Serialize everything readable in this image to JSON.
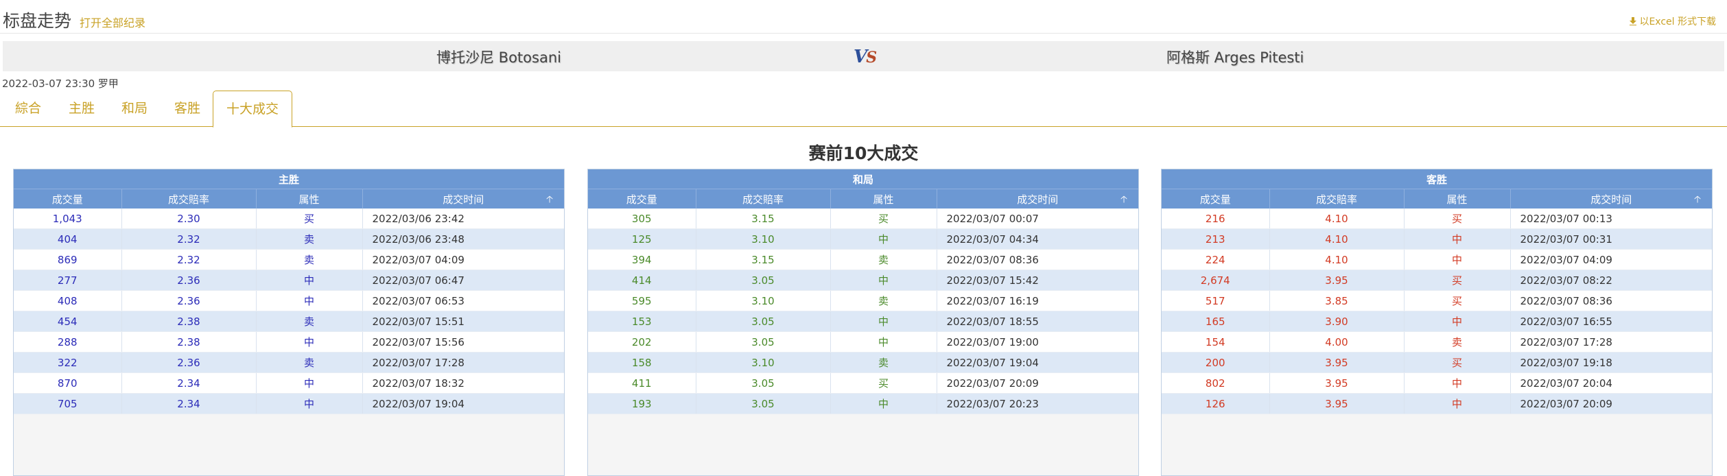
{
  "header": {
    "title": "标盘走势",
    "open_all": "打开全部纪录",
    "export_label": "以Excel 形式下载"
  },
  "match": {
    "home_team": "博托沙尼 Botosani",
    "away_team": "阿格斯 Arges Pitesti",
    "vs_v": "V",
    "vs_s": "S",
    "info": "2022-03-07 23:30 罗甲"
  },
  "tabs": [
    "綜合",
    "主胜",
    "和局",
    "客胜",
    "十大成交"
  ],
  "active_tab": "十大成交",
  "section_title": "赛前10大成交",
  "columns": [
    "成交量",
    "成交賠率",
    "属性",
    "成交时间"
  ],
  "sort_arrow": "🡡",
  "panels": {
    "home": {
      "caption": "主胜",
      "rows": [
        [
          "1,043",
          "2.30",
          "买",
          "2022/03/06 23:42"
        ],
        [
          "404",
          "2.32",
          "卖",
          "2022/03/06 23:48"
        ],
        [
          "869",
          "2.32",
          "卖",
          "2022/03/07 04:09"
        ],
        [
          "277",
          "2.36",
          "中",
          "2022/03/07 06:47"
        ],
        [
          "408",
          "2.36",
          "中",
          "2022/03/07 06:53"
        ],
        [
          "454",
          "2.38",
          "卖",
          "2022/03/07 15:51"
        ],
        [
          "288",
          "2.38",
          "中",
          "2022/03/07 15:56"
        ],
        [
          "322",
          "2.36",
          "卖",
          "2022/03/07 17:28"
        ],
        [
          "870",
          "2.34",
          "中",
          "2022/03/07 18:32"
        ],
        [
          "705",
          "2.34",
          "中",
          "2022/03/07 19:04"
        ]
      ]
    },
    "draw": {
      "caption": "和局",
      "rows": [
        [
          "305",
          "3.15",
          "买",
          "2022/03/07 00:07"
        ],
        [
          "125",
          "3.10",
          "中",
          "2022/03/07 04:34"
        ],
        [
          "394",
          "3.15",
          "卖",
          "2022/03/07 08:36"
        ],
        [
          "414",
          "3.05",
          "中",
          "2022/03/07 15:42"
        ],
        [
          "595",
          "3.10",
          "卖",
          "2022/03/07 16:19"
        ],
        [
          "153",
          "3.05",
          "中",
          "2022/03/07 18:55"
        ],
        [
          "202",
          "3.05",
          "中",
          "2022/03/07 19:00"
        ],
        [
          "158",
          "3.10",
          "卖",
          "2022/03/07 19:04"
        ],
        [
          "411",
          "3.05",
          "买",
          "2022/03/07 20:09"
        ],
        [
          "193",
          "3.05",
          "中",
          "2022/03/07 20:23"
        ]
      ]
    },
    "away": {
      "caption": "客胜",
      "rows": [
        [
          "216",
          "4.10",
          "买",
          "2022/03/07 00:13"
        ],
        [
          "213",
          "4.10",
          "中",
          "2022/03/07 00:31"
        ],
        [
          "224",
          "4.10",
          "中",
          "2022/03/07 04:09"
        ],
        [
          "2,674",
          "3.95",
          "买",
          "2022/03/07 08:22"
        ],
        [
          "517",
          "3.85",
          "买",
          "2022/03/07 08:36"
        ],
        [
          "165",
          "3.90",
          "中",
          "2022/03/07 16:55"
        ],
        [
          "154",
          "4.00",
          "卖",
          "2022/03/07 17:28"
        ],
        [
          "200",
          "3.95",
          "买",
          "2022/03/07 19:18"
        ],
        [
          "802",
          "3.95",
          "中",
          "2022/03/07 20:04"
        ],
        [
          "126",
          "3.95",
          "中",
          "2022/03/07 20:09"
        ]
      ]
    }
  },
  "colors": {
    "accent": "#c9a227",
    "table_header": "#6c98d3",
    "home_text": "#2b2bb8",
    "draw_text": "#4a8a2a",
    "away_text": "#d23a23"
  }
}
